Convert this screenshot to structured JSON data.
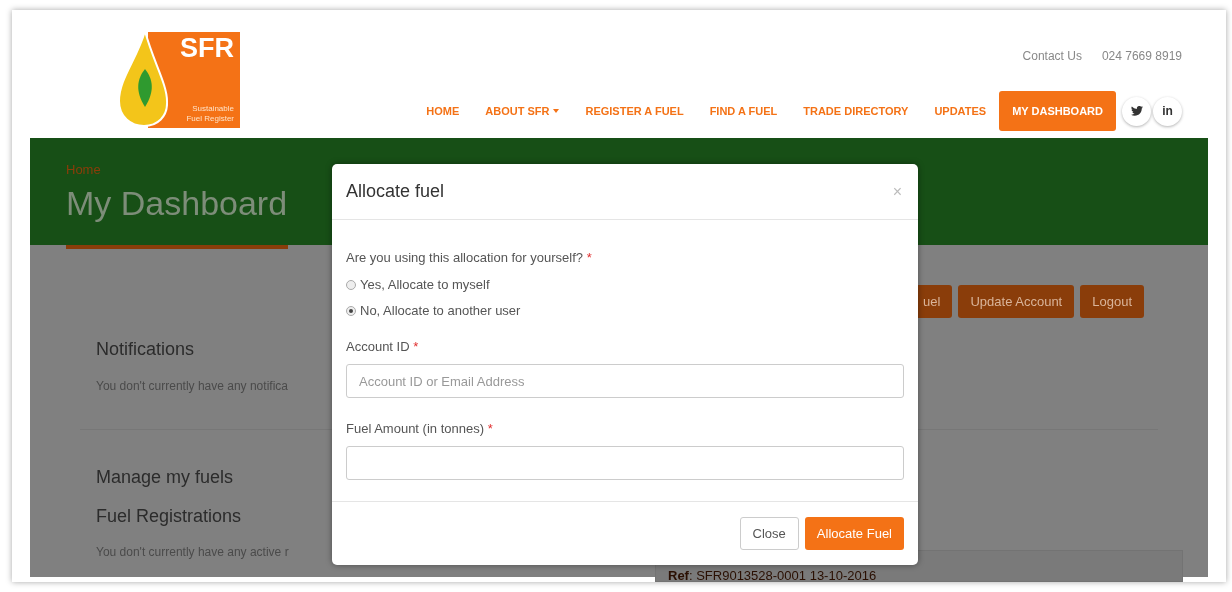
{
  "header": {
    "logo": {
      "text": "SFR",
      "tagline_1": "Sustainable",
      "tagline_2": "Fuel Register"
    },
    "contact": {
      "label": "Contact Us",
      "phone": "024 7669 8919"
    },
    "nav": [
      {
        "label": "HOME",
        "selected": false,
        "dropdown": false
      },
      {
        "label": "ABOUT SFR",
        "selected": false,
        "dropdown": true
      },
      {
        "label": "REGISTER A FUEL",
        "selected": false,
        "dropdown": false
      },
      {
        "label": "FIND A FUEL",
        "selected": false,
        "dropdown": false
      },
      {
        "label": "TRADE DIRECTORY",
        "selected": false,
        "dropdown": false
      },
      {
        "label": "UPDATES",
        "selected": false,
        "dropdown": false
      },
      {
        "label": "MY DASHBOARD",
        "selected": true,
        "dropdown": false
      }
    ],
    "social": [
      {
        "kind": "twitter"
      },
      {
        "kind": "linkedin",
        "text": "in"
      }
    ]
  },
  "banner": {
    "breadcrumb": "Home",
    "title": "My Dashboard"
  },
  "actions": [
    "uel",
    "Update Account",
    "Logout"
  ],
  "notifications": {
    "heading": "Notifications",
    "text": "You don't currently have any notifica"
  },
  "fuels": {
    "heading": "Manage my fuels",
    "subheading": "Fuel Registrations",
    "text": "You don't currently have any active r",
    "ref": "**Ref**: SFR9013528-0001 13-10-2016"
  },
  "modal": {
    "title": "Allocate fuel",
    "close": "×",
    "question": "Are you using this allocation for yourself?",
    "required_mark": "*",
    "options": [
      {
        "label": "Yes, Allocate to myself",
        "selected": false
      },
      {
        "label": "No, Allocate to another user",
        "selected": true
      }
    ],
    "fields": [
      {
        "label": "Account ID",
        "placeholder": "Account ID or Email Address"
      },
      {
        "label": "Fuel Amount (in tonnes)"
      }
    ],
    "buttons": [
      {
        "label": "Close",
        "kind": "default"
      },
      {
        "label": "Allocate Fuel",
        "kind": "primary"
      }
    ]
  }
}
